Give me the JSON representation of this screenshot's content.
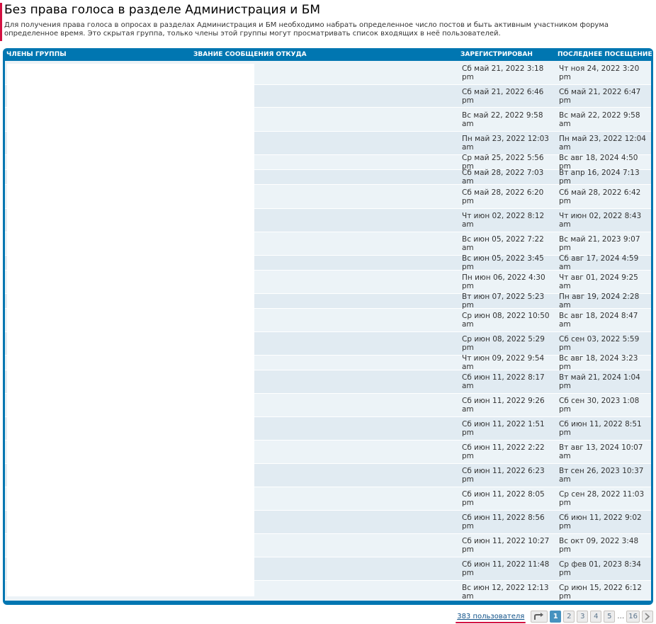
{
  "page": {
    "title": "Без права голоса в разделе Администрация и БМ",
    "description": "Для получения права голоса в опросах в разделах Администрация и БМ необходимо набрать определенное число постов и быть активным участником форума определенное время. Это скрытая группа, только члены этой группы могут просматривать список входящих в неё пользователей."
  },
  "table": {
    "headers": {
      "members": "ЧЛЕНЫ ГРУППЫ",
      "rank_posts_from": "ЗВАНИЕ СООБЩЕНИЯ ОТКУДА",
      "registered": "ЗАРЕГИСТРИРОВАН",
      "last_visit": "ПОСЛЕДНЕЕ ПОСЕЩЕНИЕ"
    },
    "rows": [
      {
        "registered": "Сб май 21, 2022 3:18 pm",
        "last_visit": "Чт ноя 24, 2022 3:20 pm"
      },
      {
        "registered": "Сб май 21, 2022 6:46 pm",
        "last_visit": "Сб май 21, 2022 6:47 pm"
      },
      {
        "registered": "Вс май 22, 2022 9:58 am",
        "last_visit": "Вс май 22, 2022 9:58 am"
      },
      {
        "registered": "Пн май 23, 2022 12:03 am",
        "last_visit": "Пн май 23, 2022 12:04 am"
      },
      {
        "registered": "Ср май 25, 2022 5:56 pm",
        "last_visit": "Вс авг 18, 2024 4:50 pm"
      },
      {
        "registered": "Сб май 28, 2022 7:03 am",
        "last_visit": "Вт апр 16, 2024 7:13 pm"
      },
      {
        "registered": "Сб май 28, 2022 6:20 pm",
        "last_visit": "Сб май 28, 2022 6:42 pm"
      },
      {
        "registered": "Чт июн 02, 2022 8:12 am",
        "last_visit": "Чт июн 02, 2022 8:43 am"
      },
      {
        "registered": "Вс июн 05, 2022 7:22 am",
        "last_visit": "Вс май 21, 2023 9:07 pm"
      },
      {
        "registered": "Вс июн 05, 2022 3:45 pm",
        "last_visit": "Сб авг 17, 2024 4:59 am"
      },
      {
        "registered": "Пн июн 06, 2022 4:30 pm",
        "last_visit": "Чт авг 01, 2024 9:25 am"
      },
      {
        "registered": "Вт июн 07, 2022 5:23 pm",
        "last_visit": "Пн авг 19, 2024 2:28 am"
      },
      {
        "registered": "Ср июн 08, 2022 10:50 am",
        "last_visit": "Вс авг 18, 2024 8:47 am"
      },
      {
        "registered": "Ср июн 08, 2022 5:29 pm",
        "last_visit": "Сб сен 03, 2022 5:59 pm"
      },
      {
        "registered": "Чт июн 09, 2022 9:54 am",
        "last_visit": "Вс авг 18, 2024 3:23 pm"
      },
      {
        "registered": "Сб июн 11, 2022 8:17 am",
        "last_visit": "Вт май 21, 2024 1:04 pm"
      },
      {
        "registered": "Сб июн 11, 2022 9:26 am",
        "last_visit": "Сб сен 30, 2023 1:08 pm"
      },
      {
        "registered": "Сб июн 11, 2022 1:51 pm",
        "last_visit": "Сб июн 11, 2022 8:51 pm"
      },
      {
        "registered": "Сб июн 11, 2022 2:22 pm",
        "last_visit": "Вт авг 13, 2024 10:07 am"
      },
      {
        "registered": "Сб июн 11, 2022 6:23 pm",
        "last_visit": "Вт сен 26, 2023 10:37 am"
      },
      {
        "registered": "Сб июн 11, 2022 8:05 pm",
        "last_visit": "Ср сен 28, 2022 11:03 pm"
      },
      {
        "registered": "Сб июн 11, 2022 8:56 pm",
        "last_visit": "Сб июн 11, 2022 9:02 pm"
      },
      {
        "registered": "Сб июн 11, 2022 10:27 pm",
        "last_visit": "Вс окт 09, 2022 3:48 pm"
      },
      {
        "registered": "Сб июн 11, 2022 11:48 pm",
        "last_visit": "Ср фев 01, 2023 8:34 pm"
      },
      {
        "registered": "Вс июн 12, 2022 12:13 am",
        "last_visit": "Ср июн 15, 2022 6:12 pm"
      }
    ]
  },
  "pagination": {
    "user_count": "383 пользователя",
    "jump_icon": "jump-to-page-icon",
    "pages": [
      "1",
      "2",
      "3",
      "4",
      "5"
    ],
    "ellipsis": "…",
    "last_page": "16",
    "next_icon": "chevron-right-icon",
    "active_page": "1"
  },
  "colors": {
    "accent": "#0076b1",
    "marker": "#d31141",
    "row_odd": "#ecf3f7",
    "row_even": "#e1ebf2",
    "active_page": "#4692bf"
  }
}
